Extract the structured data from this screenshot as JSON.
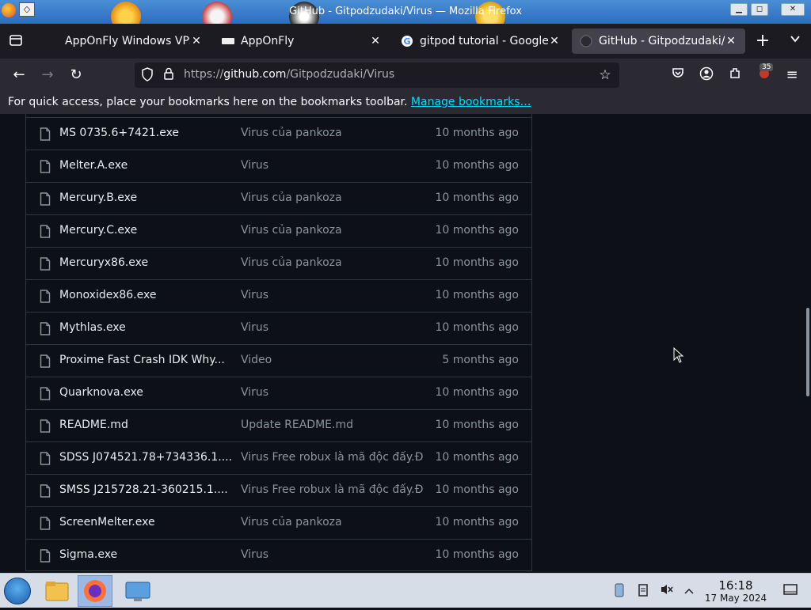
{
  "window": {
    "title": "GitHub - Gitpodzudaki/Virus — Mozilla Firefox",
    "controls": [
      "▁",
      "◻",
      "✕"
    ]
  },
  "tabs": [
    {
      "label": "AppOnFly Windows VPS (",
      "icon": "apponfly-icon",
      "active": false
    },
    {
      "label": "AppOnFly",
      "icon": "apponfly-logo-icon",
      "active": false
    },
    {
      "label": "gitpod tutorial - Google S",
      "icon": "google-icon",
      "active": false
    },
    {
      "label": "GitHub - Gitpodzudaki/Vi",
      "icon": "github-icon",
      "active": true
    }
  ],
  "navbar": {
    "url_prefix": "https://",
    "url_host": "github.com",
    "url_path": "/Gitpodzudaki/Virus",
    "badge": "35"
  },
  "bookmarks": {
    "message": "For quick access, place your bookmarks here on the bookmarks toolbar.",
    "link": "Manage bookmarks…"
  },
  "files": [
    {
      "name": "MS 0735.6+7421.exe",
      "message": "Virus của pankoza",
      "date": "10 months ago"
    },
    {
      "name": "Melter.A.exe",
      "message": "Virus",
      "date": "10 months ago"
    },
    {
      "name": "Mercury.B.exe",
      "message": "Virus của pankoza",
      "date": "10 months ago"
    },
    {
      "name": "Mercury.C.exe",
      "message": "Virus của pankoza",
      "date": "10 months ago"
    },
    {
      "name": "Mercuryx86.exe",
      "message": "Virus của pankoza",
      "date": "10 months ago"
    },
    {
      "name": "Monoxidex86.exe",
      "message": "Virus",
      "date": "10 months ago"
    },
    {
      "name": "Mythlas.exe",
      "message": "Virus",
      "date": "10 months ago"
    },
    {
      "name": "Proxime Fast Crash IDK Why...",
      "message": "Video",
      "date": "5 months ago"
    },
    {
      "name": "Quarknova.exe",
      "message": "Virus",
      "date": "10 months ago"
    },
    {
      "name": "README.md",
      "message": "Update README.md",
      "date": "10 months ago"
    },
    {
      "name": "SDSS J074521.78+734336.1....",
      "message": "Virus Free robux là mã độc đấy.Đ...",
      "date": "10 months ago"
    },
    {
      "name": "SMSS J215728.21-360215.1....",
      "message": "Virus Free robux là mã độc đấy.Đ...",
      "date": "10 months ago"
    },
    {
      "name": "ScreenMelter.exe",
      "message": "Virus của pankoza",
      "date": "10 months ago"
    },
    {
      "name": "Sigma.exe",
      "message": "Virus",
      "date": "10 months ago"
    }
  ],
  "taskbar": {
    "time": "16:18",
    "date": "17 May 2024"
  },
  "colors": {
    "page_bg": "#0d1117",
    "border": "#30363d",
    "text": "#e6edf3",
    "muted": "#8b949e",
    "link": "#00ddff"
  }
}
